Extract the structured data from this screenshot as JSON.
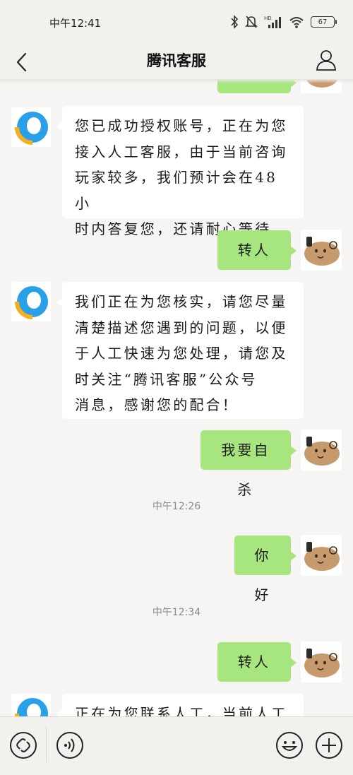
{
  "status_bar": {
    "time": "中午12:41",
    "battery": "67",
    "icons": [
      "bluetooth-icon",
      "mute-bell-icon",
      "hd-signal-icon",
      "wifi-icon",
      "battery-icon"
    ]
  },
  "header": {
    "title": "腾讯客服",
    "back_icon": "chevron-left-icon",
    "profile_icon": "person-icon"
  },
  "messages": {
    "m1": {
      "line1": "您已成功授权账号，正在为您",
      "line2": "接入人工客服，由于当前咨询",
      "line3": "玩家较多，我们预计会在48小",
      "line4": "时内答复您，还请耐心等待。"
    },
    "m2": {
      "text": "转人工"
    },
    "m3": {
      "line1": "我们正在为您核实，请您尽量",
      "line2": "清楚描述您遇到的问题，以便",
      "line3": "于人工快速为您处理，请您及",
      "line4": "时关注“腾讯客服”公众号",
      "line5": "消息，感谢您的配合！"
    },
    "m4": {
      "text": "我要自杀"
    },
    "ts1": "中午12:26",
    "m5": {
      "text": "你好"
    },
    "ts2": "中午12:34",
    "m6": {
      "text": "转人工"
    },
    "m7": {
      "line1": "正在为您联系人工，当前人工"
    }
  },
  "bottom_bar": {
    "icons": [
      "link-icon",
      "voice-icon",
      "emoji-icon",
      "plus-icon"
    ]
  },
  "colors": {
    "outgoing_bubble": "#a7e67f",
    "incoming_bubble": "#ffffff",
    "background": "#f6f5f3"
  }
}
